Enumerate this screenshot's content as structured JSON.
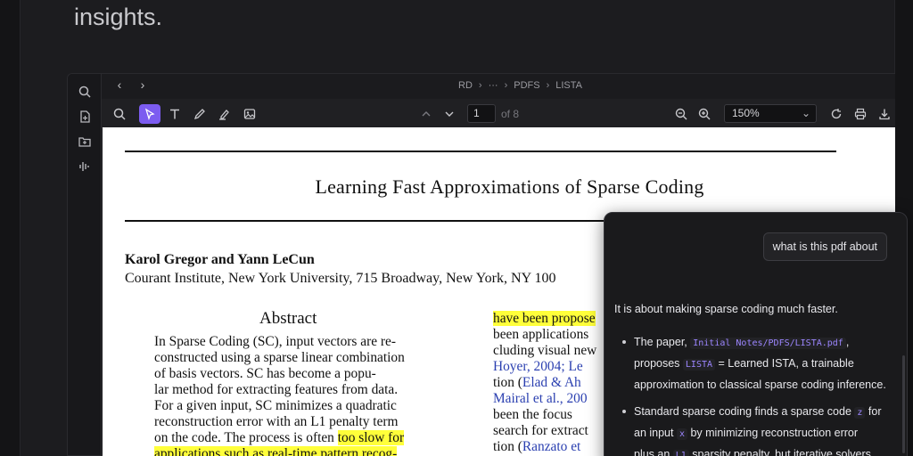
{
  "headline": "insights.",
  "nav": {
    "back": "‹",
    "forward": "›",
    "breadcrumbs": [
      "RD",
      "···",
      "PDFS",
      "LISTA"
    ]
  },
  "toolbar": {
    "page_current": "1",
    "page_of": "of 8",
    "zoom": "150%"
  },
  "paper": {
    "title": "Learning Fast Approximations of Sparse Coding",
    "authors": "Karol Gregor and Yann LeCun",
    "affiliation": "Courant Institute, New York University, 715 Broadway, New York, NY 100",
    "abstract_heading": "Abstract",
    "abstract_lines": [
      "In Sparse Coding (SC), input vectors are re-",
      "constructed using a sparse linear combination",
      "of basis vectors.  SC has become a popu-",
      "lar method for extracting features from data.",
      "For a given input, SC minimizes a quadratic",
      "reconstruction error with an L1 penalty term"
    ],
    "abstract_line7_pre": "on the code.  The process is often ",
    "abstract_line7_hl": "too slow for",
    "abstract_line8_hl": "applications such as real-time pattern recog-",
    "col2_line1_hl": "have been propose",
    "col2_line2": "been applications",
    "col2_line3": "cluding visual new",
    "col2_line4_blue": "Hoyer, 2004;  Le",
    "col2_line5_pre": "tion (",
    "col2_line5_blue": "Elad & Ah",
    "col2_line6_blue": "Mairal et al., 200",
    "col2_line7": "been  the  focus",
    "col2_line8": "search for extract",
    "col2_line9_pre": "tion (",
    "col2_line9_blue": "Ranzato et"
  },
  "chat": {
    "user_message": "what is this pdf about",
    "intro": "It is about making sparse coding much faster.",
    "b1_a": "The paper, ",
    "b1_code": "Initial Notes/PDFS/LISTA.pdf",
    "b1_b": ",",
    "b1_c": "proposes ",
    "b1_code2": "LISTA",
    "b1_d": " = Learned ISTA, a trainable",
    "b1_e": "approximation to classical sparse coding inference.",
    "b2_a": "Standard sparse coding finds a sparse code ",
    "b2_code": "z",
    "b2_b": " for",
    "b2_c": "an input ",
    "b2_code2": "x",
    "b2_d": " by minimizing reconstruction error",
    "b2_e": "plus an ",
    "b2_code3": "L1",
    "b2_f": " sparsity penalty, but iterative solvers"
  },
  "colors": {
    "accent": "#7c5cf0",
    "highlight": "#ffff3a",
    "link_blue": "#2a3fb0"
  }
}
